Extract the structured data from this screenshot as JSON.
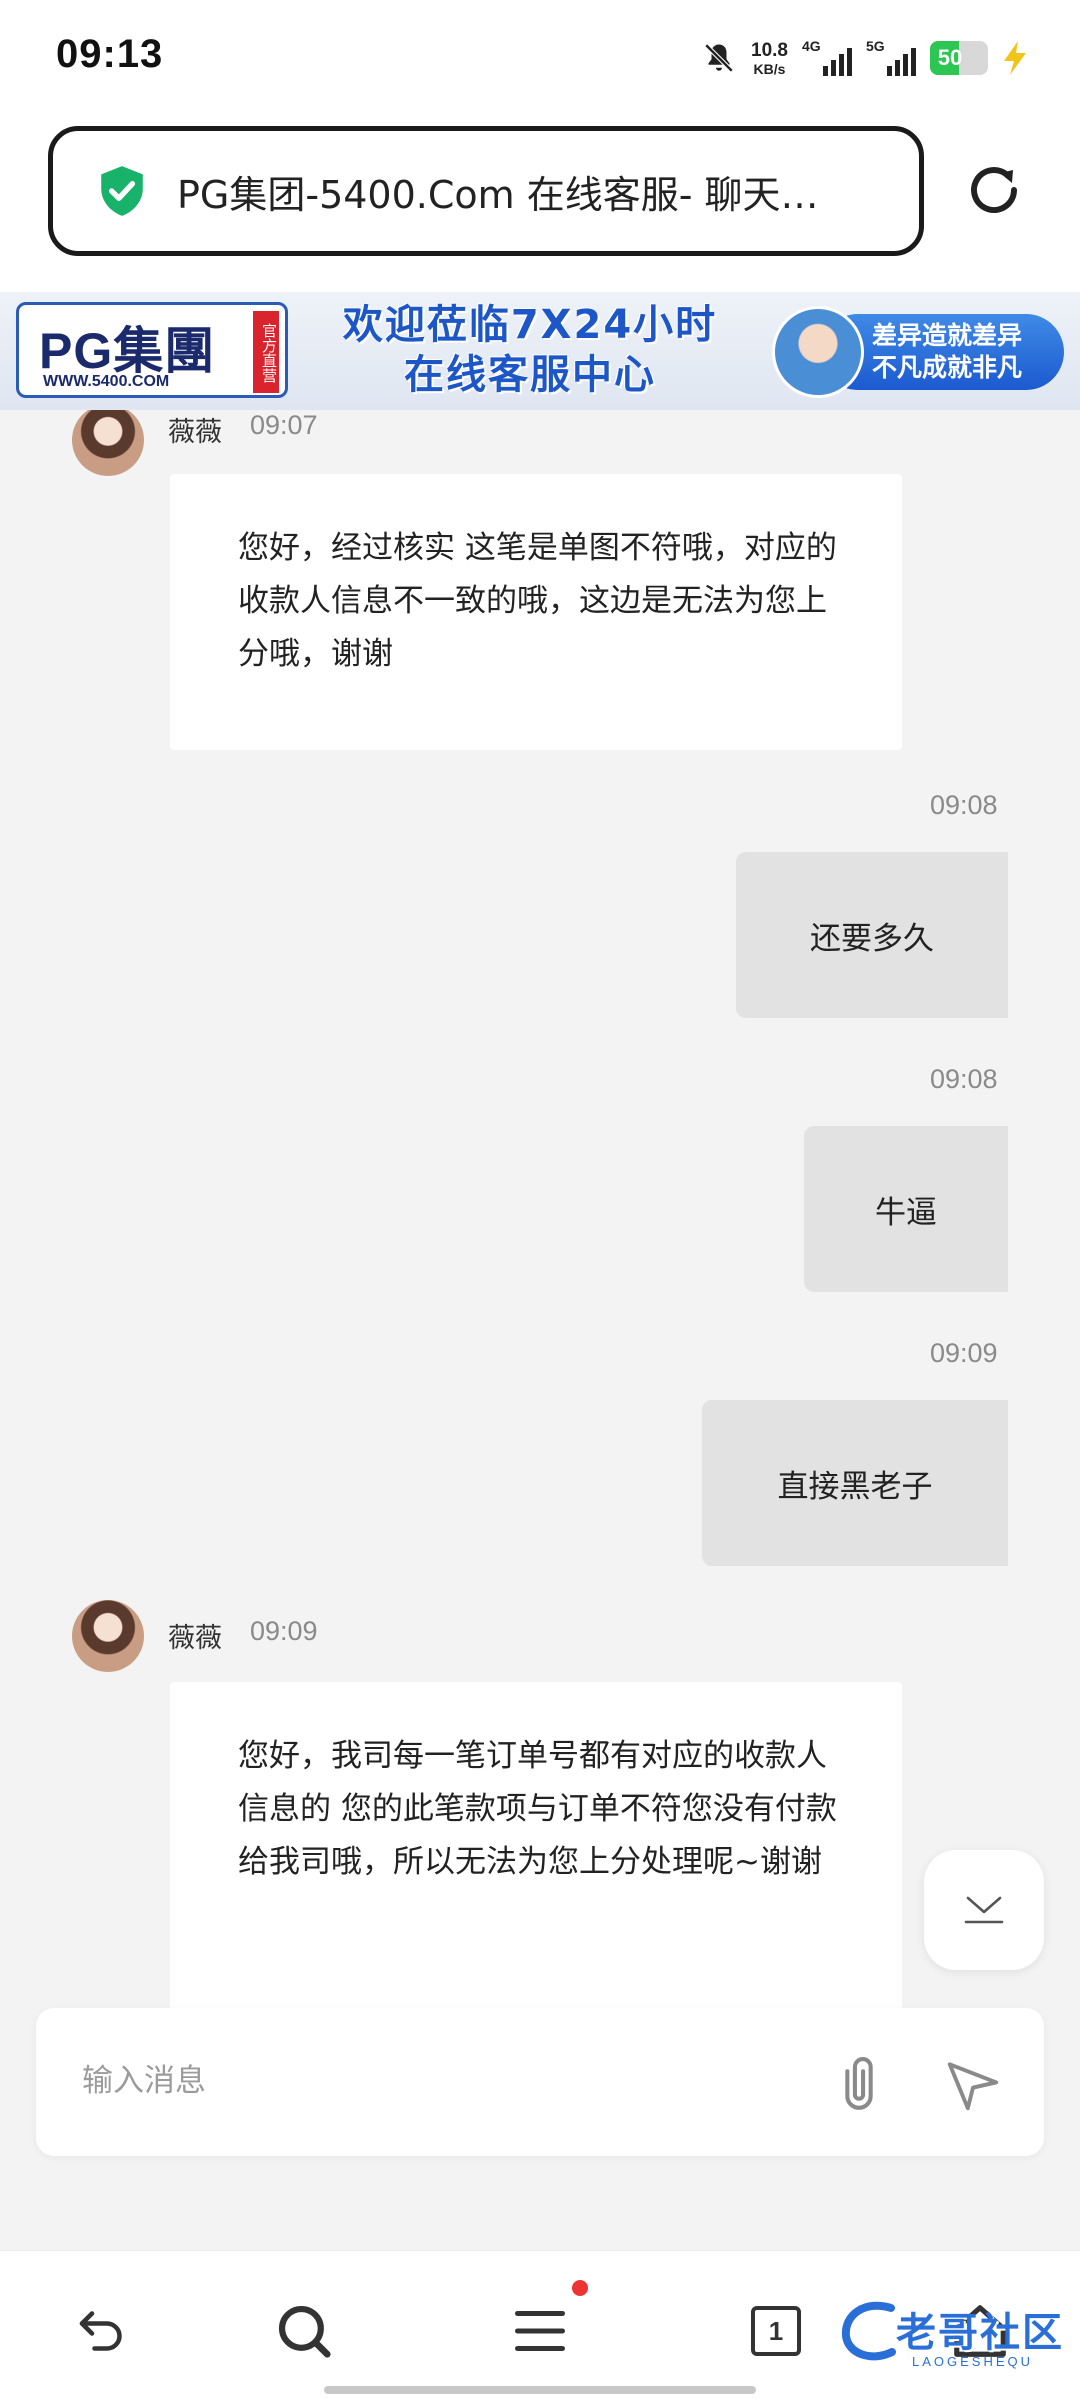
{
  "status_bar": {
    "time": "09:13",
    "net_speed": "10.8",
    "net_unit": "KB/s",
    "signal1": "4G",
    "signal2": "5G",
    "battery": "50",
    "battery_percent": 50,
    "battery_color": "#2dc653"
  },
  "browser": {
    "page_title": "PG集团-5400.Com 在线客服- 聊天…",
    "secure_icon": "shield-check-icon",
    "reload_icon": "reload-icon"
  },
  "banner": {
    "logo_text": "PG集團",
    "logo_tag": "官方直营",
    "logo_url": "WWW.5400.COM",
    "headline_line1": "欢迎莅临7X24小时",
    "headline_line2": "在线客服中心",
    "slogan_line1": "差异造就差异",
    "slogan_line2": "不凡成就非凡",
    "accent_color": "#1c56c7"
  },
  "chat": {
    "messages": [
      {
        "from": "agent",
        "sender": "薇薇",
        "time": "09:07",
        "text": "您好，经过核实 这笔是单图不符哦，对应的收款人信息不一致的哦，这边是无法为您上分哦，谢谢"
      },
      {
        "from": "user",
        "time": "09:08",
        "text": "还要多久"
      },
      {
        "from": "user",
        "time": "09:08",
        "text": "牛逼"
      },
      {
        "from": "user",
        "time": "09:09",
        "text": "直接黑老子"
      },
      {
        "from": "agent",
        "sender": "薇薇",
        "time": "09:09",
        "text": "您好，我司每一笔订单号都有对应的收款人信息的 您的此笔款项与订单不符您没有付款给我司哦，所以无法为您上分处理呢~谢谢"
      }
    ]
  },
  "composer": {
    "placeholder": "输入消息",
    "attach_icon": "paperclip-icon",
    "send_icon": "send-icon"
  },
  "bottom_nav": {
    "back_icon": "back-icon",
    "search_icon": "search-icon",
    "menu_icon": "menu-icon",
    "tabs_count": "1",
    "home_icon": "home-icon",
    "watermark": "老哥社区",
    "watermark_sub": "LAOGESHEQU"
  }
}
